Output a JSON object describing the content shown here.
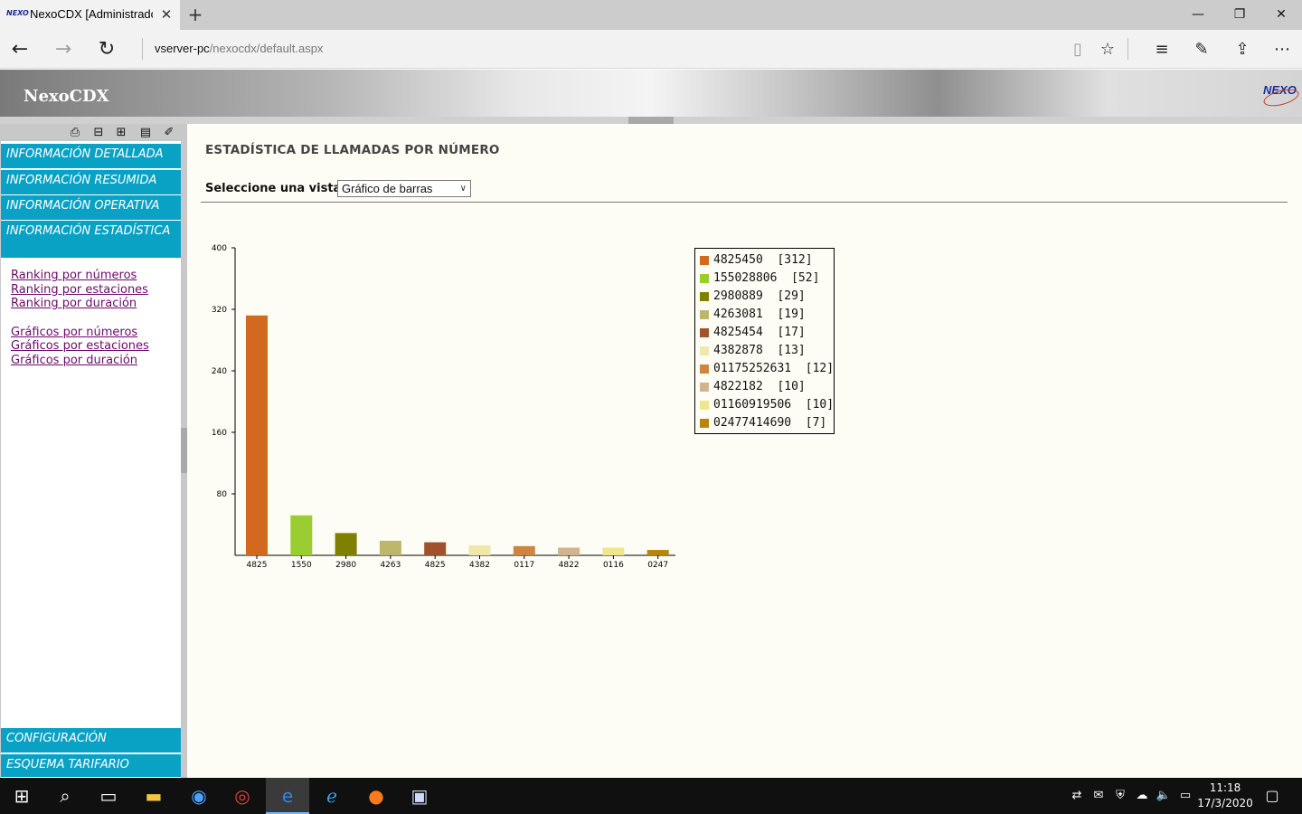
{
  "browser": {
    "tab_title": "NexoCDX [Administrador]",
    "url_host": "vserver-pc",
    "url_path": "/nexocdx/default.aspx"
  },
  "app": {
    "title": "NexoCDX",
    "logo_text": "NEXO"
  },
  "sidebar": {
    "menu": [
      {
        "label": "INFORMACIÓN DETALLADA"
      },
      {
        "label": "INFORMACIÓN RESUMIDA"
      },
      {
        "label": "INFORMACIÓN OPERATIVA"
      },
      {
        "label": "INFORMACIÓN ESTADÍSTICA"
      }
    ],
    "links_group1": [
      "Ranking por números",
      "Ranking por estaciones",
      "Ranking por duración"
    ],
    "links_group2": [
      "Gráficos por números",
      "Gráficos por estaciones",
      "Gráficos por duración"
    ],
    "bottom_menu": [
      {
        "label": "CONFIGURACIÓN"
      },
      {
        "label": "ESQUEMA TARIFARIO"
      }
    ]
  },
  "main": {
    "page_title": "ESTADÍSTICA DE LLAMADAS POR NÚMERO",
    "view_label": "Seleccione una vista:",
    "view_selected": "Gráfico de barras"
  },
  "chart_data": {
    "type": "bar",
    "categories": [
      "4825",
      "1550",
      "2980",
      "4263",
      "4825",
      "4382",
      "0117",
      "4822",
      "0116",
      "0247"
    ],
    "values": [
      312,
      52,
      29,
      19,
      17,
      13,
      12,
      10,
      10,
      7
    ],
    "colors": [
      "#d2691e",
      "#9acd32",
      "#808000",
      "#bdb76b",
      "#a0522d",
      "#eee8aa",
      "#cd853f",
      "#d2b48c",
      "#f0e68c",
      "#b8860b"
    ],
    "yticks": [
      80,
      160,
      240,
      320,
      400
    ],
    "ylim": [
      0,
      400
    ],
    "legend": [
      "4825450  [312]",
      "155028806  [52]",
      "2980889  [29]",
      "4263081  [19]",
      "4825454  [17]",
      "4382878  [13]",
      "01175252631  [12]",
      "4822182  [10]",
      "01160919506  [10]",
      "02477414690  [7]"
    ],
    "legend_position": "right"
  },
  "taskbar": {
    "time": "11:18",
    "date": "17/3/2020"
  }
}
